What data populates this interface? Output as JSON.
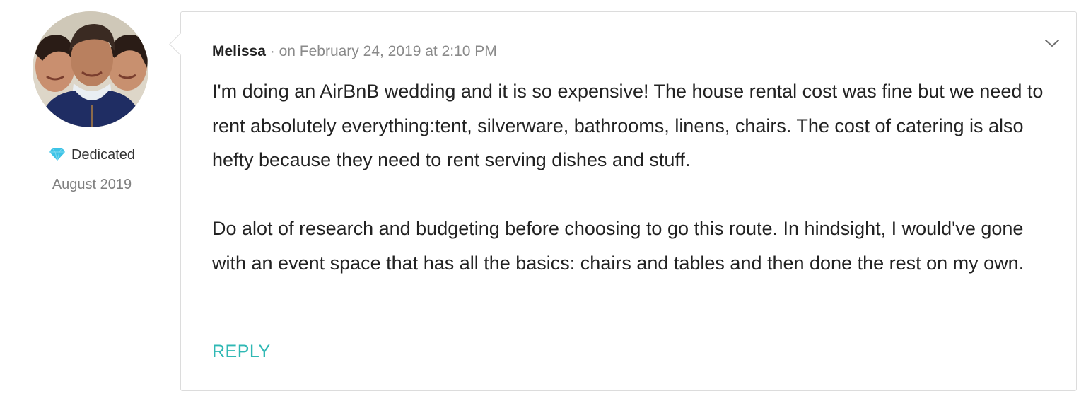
{
  "author": {
    "name": "Melissa",
    "badge": {
      "icon": "diamond-icon",
      "label": "Dedicated",
      "color": "#3cc3e6"
    },
    "member_since": "August 2019"
  },
  "comment": {
    "separator": "·",
    "date": "on February 24, 2019 at 2:10 PM",
    "paragraphs": [
      "I'm doing an AirBnB wedding and it is so expensive! The house rental cost was fine but we need to rent absolutely everything:tent, silverware, bathrooms, linens, chairs. The cost of catering is also hefty because they need to rent serving dishes and stuff.",
      "Do alot of research and budgeting before choosing to go this route. In hindsight, I would've gone with an event space that has all the basics: chairs and tables and then done the rest on my own."
    ],
    "reply_label": "REPLY",
    "menu_icon": "chevron-down-icon"
  },
  "colors": {
    "accent": "#2fb8b4",
    "text": "#222222",
    "muted": "#8a8a8a",
    "border": "#dcdcdc"
  }
}
